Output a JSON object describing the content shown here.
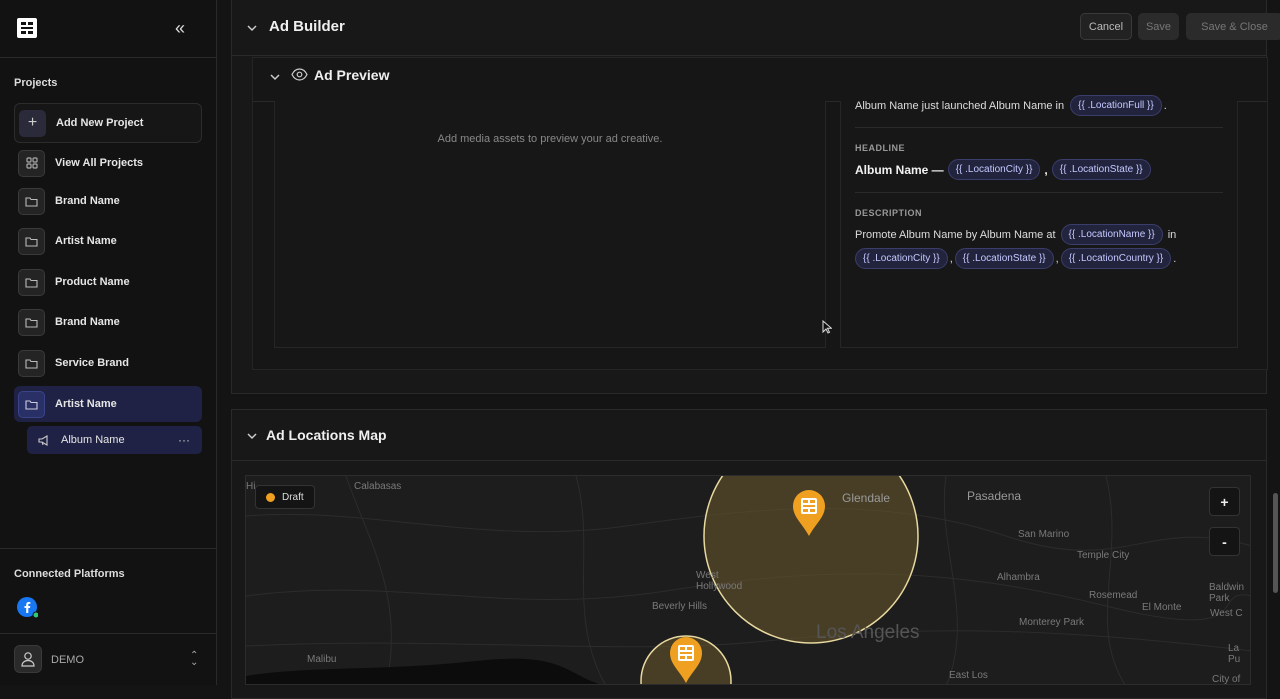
{
  "sidebar": {
    "projects_heading": "Projects",
    "add_project": "Add New Project",
    "view_all": "View All Projects",
    "projects": [
      {
        "label": "Brand Name"
      },
      {
        "label": "Artist Name"
      },
      {
        "label": "Product Name"
      },
      {
        "label": "Brand Name"
      },
      {
        "label": "Service Brand"
      },
      {
        "label": "Artist Name",
        "active": true
      }
    ],
    "sub_item": "Album Name",
    "connected_heading": "Connected Platforms",
    "user": "DEMO"
  },
  "ad_builder": {
    "title": "Ad Builder",
    "cancel": "Cancel",
    "save": "Save",
    "save_close": "Save & Close"
  },
  "ad_preview": {
    "title": "Ad Preview",
    "media_message": "Add media assets to preview your ad creative.",
    "primary_text": {
      "text": "Album Name just launched Album Name in",
      "tag": "{{ .LocationFull }}",
      "end": "."
    },
    "headline_label": "HEADLINE",
    "headline": {
      "text": "Album Name —",
      "tag1": "{{ .LocationCity }}",
      "sep": ",",
      "tag2": "{{ .LocationState }}"
    },
    "description_label": "DESCRIPTION",
    "description": {
      "text": "Promote Album Name by Album Name at",
      "tag1": "{{ .LocationName }}",
      "in": "in",
      "tag2": "{{ .LocationCity }}",
      "tag3": "{{ .LocationState }}",
      "tag4": "{{ .LocationCountry }}",
      "comma": ",",
      "end": "."
    }
  },
  "map": {
    "title": "Ad Locations Map",
    "status": "Draft",
    "zoom_in": "+",
    "zoom_out": "-",
    "labels": {
      "calabasas": "Calabasas",
      "glendale": "Glendale",
      "pasadena": "Pasadena",
      "san_marino": "San Marino",
      "temple_city": "Temple City",
      "west_hollywood": "West\nHollywood",
      "alhambra": "Alhambra",
      "baldwin_park": "Baldwin Park",
      "beverly_hills": "Beverly Hills",
      "rosemead": "Rosemead",
      "el_monte": "El Monte",
      "west_c": "West C",
      "los_angeles": "Los Angeles",
      "monterey_park": "Monterey Park",
      "malibu": "Malibu",
      "east_los": "East Los",
      "la_pu": "La Pu",
      "city_of": "City of",
      "hi": "Hi"
    },
    "colors": {
      "pin": "#f0a020",
      "radius_fill": "#6b5a2e",
      "radius_stroke": "#e8d9a0"
    }
  }
}
